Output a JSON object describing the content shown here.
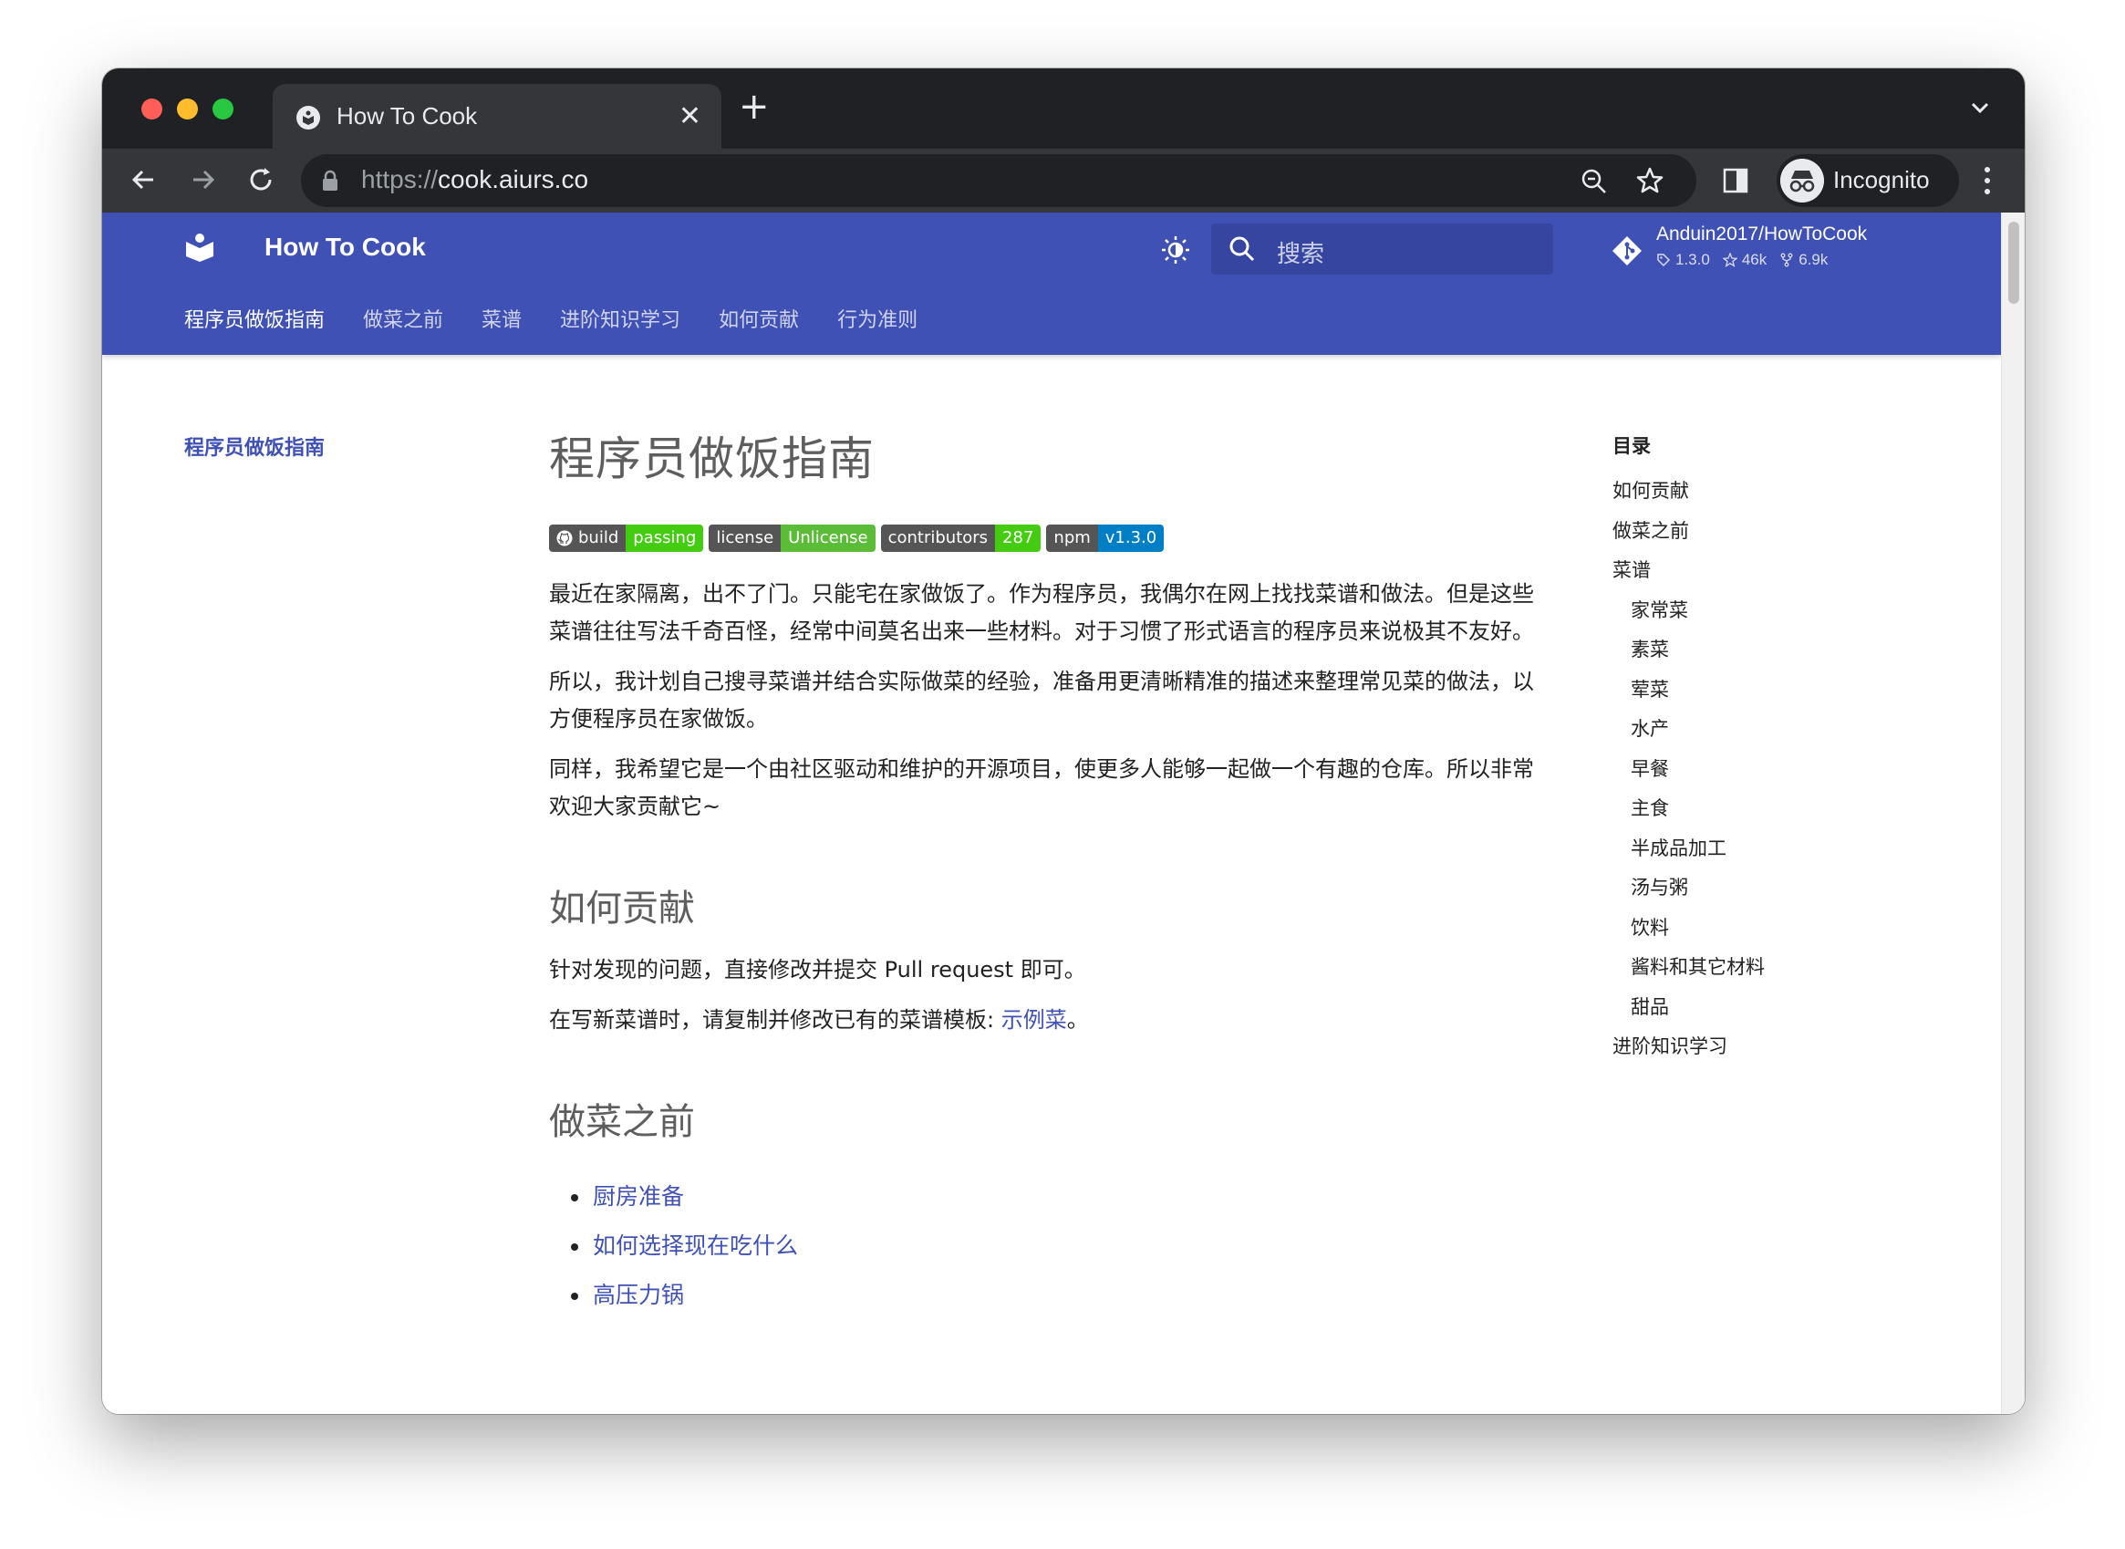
{
  "browser": {
    "tab_title": "How To Cook",
    "tab_close": "✕",
    "new_tab": "+",
    "url_scheme": "https://",
    "url_host": "cook.aiurs.co",
    "profile_label": "Incognito"
  },
  "site": {
    "title": "How To Cook",
    "search_placeholder": "搜索",
    "repo": {
      "name": "Anduin2017/HowToCook",
      "version": "1.3.0",
      "stars": "46k",
      "forks": "6.9k"
    },
    "nav_tabs": [
      {
        "label": "程序员做饭指南",
        "active": true
      },
      {
        "label": "做菜之前",
        "active": false
      },
      {
        "label": "菜谱",
        "active": false
      },
      {
        "label": "进阶知识学习",
        "active": false
      },
      {
        "label": "如何贡献",
        "active": false
      },
      {
        "label": "行为准则",
        "active": false
      }
    ],
    "brand_color": "#4051b5"
  },
  "left_nav": {
    "current": "程序员做饭指南"
  },
  "article": {
    "title": "程序员做饭指南",
    "badges": [
      {
        "label": "build",
        "value": "passing",
        "color": "#44cc11",
        "icon": "github-icon"
      },
      {
        "label": "license",
        "value": "Unlicense",
        "color": "#4c1",
        "icon": ""
      },
      {
        "label": "contributors",
        "value": "287",
        "color": "#44cc11",
        "icon": ""
      },
      {
        "label": "npm",
        "value": "v1.3.0",
        "color": "#007ec6",
        "icon": ""
      }
    ],
    "paragraphs": [
      "最近在家隔离，出不了门。只能宅在家做饭了。作为程序员，我偶尔在网上找找菜谱和做法。但是这些菜谱往往写法千奇百怪，经常中间莫名出来一些材料。对于习惯了形式语言的程序员来说极其不友好。",
      "所以，我计划自己搜寻菜谱并结合实际做菜的经验，准备用更清晰精准的描述来整理常见菜的做法，以方便程序员在家做饭。",
      "同样，我希望它是一个由社区驱动和维护的开源项目，使更多人能够一起做一个有趣的仓库。所以非常欢迎大家贡献它~"
    ],
    "section_contribute": {
      "heading": "如何贡献",
      "p1": "针对发现的问题，直接修改并提交 Pull request 即可。",
      "p2_prefix": "在写新菜谱时，请复制并修改已有的菜谱模板: ",
      "p2_link": "示例菜",
      "p2_suffix": "。"
    },
    "section_before": {
      "heading": "做菜之前",
      "items": [
        "厨房准备",
        "如何选择现在吃什么",
        "高压力锅"
      ]
    }
  },
  "toc": {
    "title": "目录",
    "items": [
      {
        "label": "如何贡献",
        "sub": false
      },
      {
        "label": "做菜之前",
        "sub": false
      },
      {
        "label": "菜谱",
        "sub": false
      },
      {
        "label": "家常菜",
        "sub": true
      },
      {
        "label": "素菜",
        "sub": true
      },
      {
        "label": "荤菜",
        "sub": true
      },
      {
        "label": "水产",
        "sub": true
      },
      {
        "label": "早餐",
        "sub": true
      },
      {
        "label": "主食",
        "sub": true
      },
      {
        "label": "半成品加工",
        "sub": true
      },
      {
        "label": "汤与粥",
        "sub": true
      },
      {
        "label": "饮料",
        "sub": true
      },
      {
        "label": "酱料和其它材料",
        "sub": true
      },
      {
        "label": "甜品",
        "sub": true
      },
      {
        "label": "进阶知识学习",
        "sub": false
      }
    ]
  }
}
